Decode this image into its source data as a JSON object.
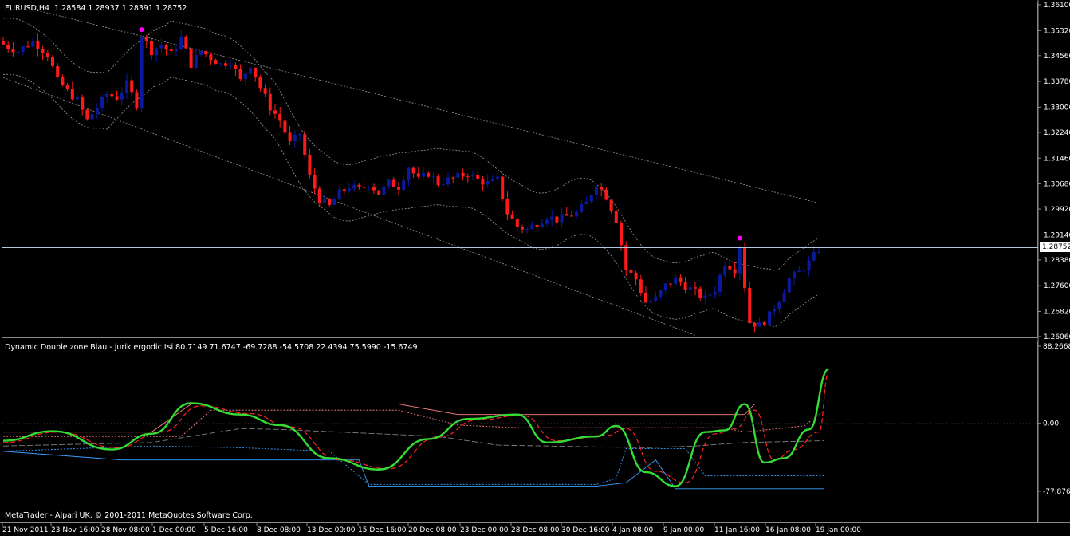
{
  "window": {
    "symbol_title": "EURUSD,H4",
    "ohlc": "1.28584 1.28937 1.28391 1.28752",
    "indicator_title": "Dynamic Double zone Blau - jurik ergodic tsi",
    "indicator_values": "80.7149 71.6747 -69.7288 -54.5708 22.4394 75.5990 -15.6749",
    "copyright": "MetaTrader - Alpari UK, © 2001-2011 MetaQuotes Software Corp.",
    "current_price_label": "1.28752"
  },
  "colors": {
    "background": "#000000",
    "bull_candle": "#0a1aa0",
    "bear_candle": "#ff1a1a",
    "signal_dot": "#ff00ff",
    "band": "#9a9a9a",
    "tsi_line": "#33dd33",
    "signal_line": "#ff2222",
    "upper_zone": "#ff8080",
    "lower_zone": "#3aa0ff",
    "middle_zone": "#808080",
    "price_line": "#b0c8e0"
  },
  "chart_data": [
    {
      "type": "candlestick",
      "symbol": "EURUSD",
      "timeframe": "H4",
      "y_ticks": [
        "1.36100",
        "1.35320",
        "1.34560",
        "1.33780",
        "1.33000",
        "1.32240",
        "1.31460",
        "1.30680",
        "1.29920",
        "1.29140",
        "1.28380",
        "1.27600",
        "1.26820",
        "1.26060"
      ],
      "ylim": [
        1.2606,
        1.361
      ],
      "current_price": 1.28752,
      "close_path": [
        [
          0,
          1.349
        ],
        [
          3,
          1.347
        ],
        [
          6,
          1.35
        ],
        [
          9,
          1.346
        ],
        [
          11,
          1.338
        ],
        [
          13,
          1.335
        ],
        [
          15,
          1.332
        ],
        [
          17,
          1.326
        ],
        [
          19,
          1.33
        ],
        [
          21,
          1.334
        ],
        [
          23,
          1.333
        ],
        [
          25,
          1.337
        ],
        [
          27,
          1.331
        ],
        [
          28,
          1.352
        ],
        [
          30,
          1.347
        ],
        [
          32,
          1.349
        ],
        [
          34,
          1.346
        ],
        [
          36,
          1.351
        ],
        [
          38,
          1.343
        ],
        [
          40,
          1.347
        ],
        [
          42,
          1.345
        ],
        [
          44,
          1.343
        ],
        [
          46,
          1.344
        ],
        [
          48,
          1.338
        ],
        [
          50,
          1.343
        ],
        [
          52,
          1.336
        ],
        [
          54,
          1.33
        ],
        [
          56,
          1.326
        ],
        [
          58,
          1.319
        ],
        [
          60,
          1.322
        ],
        [
          62,
          1.309
        ],
        [
          64,
          1.302
        ],
        [
          66,
          1.3
        ],
        [
          68,
          1.304
        ],
        [
          70,
          1.306
        ],
        [
          72,
          1.305
        ],
        [
          74,
          1.307
        ],
        [
          76,
          1.304
        ],
        [
          78,
          1.307
        ],
        [
          80,
          1.306
        ],
        [
          82,
          1.312
        ],
        [
          84,
          1.308
        ],
        [
          86,
          1.31
        ],
        [
          88,
          1.307
        ],
        [
          90,
          1.308
        ],
        [
          92,
          1.309
        ],
        [
          94,
          1.31
        ],
        [
          96,
          1.308
        ],
        [
          98,
          1.307
        ],
        [
          100,
          1.308
        ],
        [
          102,
          1.298
        ],
        [
          104,
          1.294
        ],
        [
          106,
          1.293
        ],
        [
          108,
          1.295
        ],
        [
          110,
          1.297
        ],
        [
          112,
          1.296
        ],
        [
          114,
          1.297
        ],
        [
          116,
          1.298
        ],
        [
          118,
          1.301
        ],
        [
          120,
          1.307
        ],
        [
          122,
          1.303
        ],
        [
          124,
          1.296
        ],
        [
          126,
          1.281
        ],
        [
          128,
          1.278
        ],
        [
          130,
          1.271
        ],
        [
          132,
          1.272
        ],
        [
          134,
          1.276
        ],
        [
          136,
          1.278
        ],
        [
          138,
          1.276
        ],
        [
          140,
          1.274
        ],
        [
          142,
          1.272
        ],
        [
          144,
          1.275
        ],
        [
          146,
          1.283
        ],
        [
          148,
          1.281
        ],
        [
          149,
          1.288
        ],
        [
          150,
          1.276
        ],
        [
          151,
          1.265
        ],
        [
          153,
          1.264
        ],
        [
          155,
          1.267
        ],
        [
          157,
          1.272
        ],
        [
          159,
          1.278
        ],
        [
          161,
          1.28
        ],
        [
          163,
          1.283
        ],
        [
          165,
          1.287
        ]
      ],
      "signal_dots": [
        [
          28,
          1.3535
        ],
        [
          149,
          1.2904
        ]
      ]
    },
    {
      "type": "line",
      "indicator": "Dynamic Double zone Blau - jurik ergodic tsi",
      "y_ticks": [
        "88.2668",
        "0.00",
        "-77.8769"
      ],
      "ylim": [
        -77.8769,
        88.2668
      ],
      "x_ticks": [
        "21 Nov 2011",
        "23 Nov 16:00",
        "28 Nov 08:00",
        "1 Dec 00:00",
        "5 Dec 16:00",
        "8 Dec 08:00",
        "13 Dec 00:00",
        "15 Dec 16:00",
        "20 Dec 08:00",
        "23 Dec 00:00",
        "28 Dec 08:00",
        "30 Dec 16:00",
        "4 Jan 08:00",
        "9 Jan 00:00",
        "11 Jan 16:00",
        "16 Jan 08:00",
        "19 Jan 00:00"
      ],
      "series": [
        {
          "key": "tsi",
          "values": [
            [
              0,
              -20
            ],
            [
              10,
              -9
            ],
            [
              22,
              -30
            ],
            [
              30,
              -12
            ],
            [
              38,
              23
            ],
            [
              48,
              10
            ],
            [
              56,
              -2
            ],
            [
              66,
              -40
            ],
            [
              76,
              -53
            ],
            [
              86,
              -18
            ],
            [
              94,
              5
            ],
            [
              104,
              10
            ],
            [
              110,
              -22
            ],
            [
              120,
              -15
            ],
            [
              124,
              -3
            ],
            [
              130,
              -56
            ],
            [
              136,
              -72
            ],
            [
              142,
              -10
            ],
            [
              146,
              -8
            ],
            [
              150,
              22
            ],
            [
              154,
              -45
            ],
            [
              158,
              -40
            ],
            [
              163,
              -7
            ],
            [
              167,
              62
            ]
          ]
        },
        {
          "key": "signal",
          "values": [
            [
              0,
              -22
            ],
            [
              11,
              -10
            ],
            [
              23,
              -28
            ],
            [
              32,
              -10
            ],
            [
              40,
              20
            ],
            [
              50,
              11
            ],
            [
              58,
              -4
            ],
            [
              68,
              -42
            ],
            [
              78,
              -52
            ],
            [
              88,
              -16
            ],
            [
              96,
              4
            ],
            [
              105,
              9
            ],
            [
              112,
              -20
            ],
            [
              122,
              -14
            ],
            [
              126,
              -6
            ],
            [
              132,
              -55
            ],
            [
              138,
              -68
            ],
            [
              144,
              -12
            ],
            [
              148,
              -6
            ],
            [
              152,
              15
            ],
            [
              156,
              -42
            ],
            [
              160,
              -30
            ],
            [
              165,
              -10
            ],
            [
              167,
              58
            ]
          ]
        },
        {
          "key": "upper_zone",
          "values": [
            [
              0,
              -10
            ],
            [
              30,
              -10
            ],
            [
              38,
              22
            ],
            [
              80,
              22
            ],
            [
              92,
              10
            ],
            [
              104,
              10
            ],
            [
              150,
              10
            ],
            [
              152,
              22
            ],
            [
              166,
              22
            ]
          ]
        },
        {
          "key": "upper_zone_inner",
          "values": [
            [
              0,
              -15
            ],
            [
              36,
              -15
            ],
            [
              42,
              15
            ],
            [
              80,
              15
            ],
            [
              92,
              -2
            ],
            [
              104,
              -5
            ],
            [
              146,
              -5
            ],
            [
              150,
              -10
            ],
            [
              162,
              -3
            ],
            [
              166,
              14
            ]
          ]
        },
        {
          "key": "middle_zone",
          "values": [
            [
              0,
              -26
            ],
            [
              30,
              -22
            ],
            [
              48,
              -6
            ],
            [
              56,
              -7
            ],
            [
              88,
              -15
            ],
            [
              100,
              -25
            ],
            [
              130,
              -28
            ],
            [
              140,
              -26
            ],
            [
              150,
              -22
            ],
            [
              166,
              -20
            ]
          ]
        },
        {
          "key": "lower_zone_inner",
          "values": [
            [
              0,
              -32
            ],
            [
              30,
              -26
            ],
            [
              48,
              -28
            ],
            [
              66,
              -32
            ],
            [
              74,
              -70
            ],
            [
              120,
              -70
            ],
            [
              124,
              -63
            ],
            [
              126,
              -29
            ],
            [
              138,
              -29
            ],
            [
              142,
              -60
            ],
            [
              166,
              -60
            ]
          ]
        },
        {
          "key": "lower_zone",
          "values": [
            [
              0,
              -32
            ],
            [
              24,
              -42
            ],
            [
              72,
              -42
            ],
            [
              74,
              -72
            ],
            [
              120,
              -72
            ],
            [
              126,
              -68
            ],
            [
              132,
              -42
            ],
            [
              136,
              -75
            ],
            [
              166,
              -75
            ]
          ]
        }
      ]
    }
  ]
}
